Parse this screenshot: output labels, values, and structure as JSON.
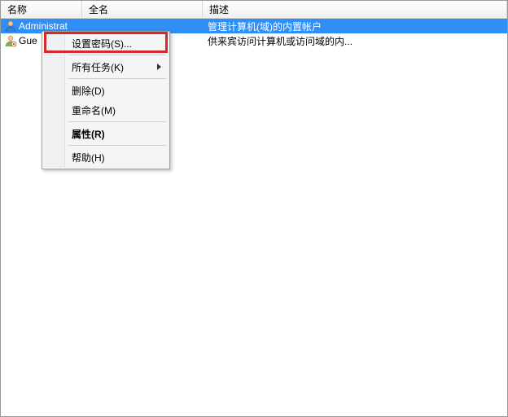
{
  "columns": {
    "name": "名称",
    "fullname": "全名",
    "desc": "描述"
  },
  "rows": [
    {
      "name": "Administrat",
      "fullname": "",
      "desc": "管理计算机(域)的内置帐户",
      "icon": "user-admin-icon"
    },
    {
      "name": "Gue",
      "fullname": "",
      "desc": "供来宾访问计算机或访问域的内...",
      "icon": "user-guest-icon"
    }
  ],
  "context_menu": {
    "set_password": "设置密码(S)...",
    "all_tasks": "所有任务(K)",
    "delete": "删除(D)",
    "rename": "重命名(M)",
    "properties": "属性(R)",
    "help": "帮助(H)"
  }
}
